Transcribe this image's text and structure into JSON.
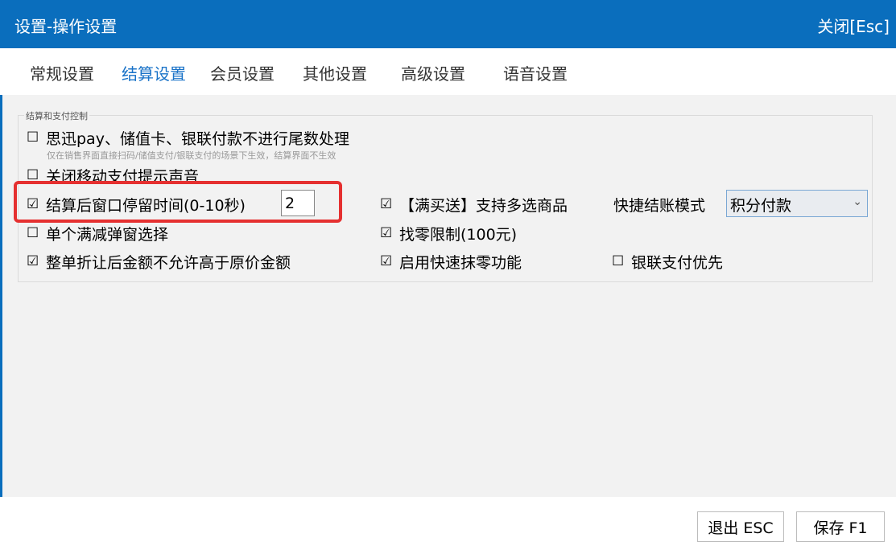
{
  "window": {
    "title": "设置-操作设置",
    "close_label": "关闭[Esc]"
  },
  "tabs": [
    {
      "label": "常规设置",
      "active": false
    },
    {
      "label": "结算设置",
      "active": true
    },
    {
      "label": "会员设置",
      "active": false
    },
    {
      "label": "其他设置",
      "active": false
    },
    {
      "label": "高级设置",
      "active": false
    },
    {
      "label": "语音设置",
      "active": false
    }
  ],
  "group": {
    "title": "结算和支付控制",
    "options": {
      "no_rounding": {
        "label": "思迅pay、储值卡、银联付款不进行尾数处理",
        "checked": false
      },
      "no_rounding_hint": "仅在销售界面直接扫码/储值支付/银联支付的场景下生效，结算界面不生效",
      "close_sound": {
        "label": "关闭移动支付提示声音",
        "checked": false
      },
      "stay_time": {
        "label": "结算后窗口停留时间(0-10秒)",
        "checked": true,
        "value": "2"
      },
      "multi_select": {
        "label": "【满买送】支持多选商品",
        "checked": true
      },
      "quick_checkout_label": "快捷结账模式",
      "quick_checkout_value": "积分付款",
      "single_popup": {
        "label": "单个满减弹窗选择",
        "checked": false
      },
      "change_limit": {
        "label": "找零限制(100元)",
        "checked": true
      },
      "discount_limit": {
        "label": "整单折让后金额不允许高于原价金额",
        "checked": true
      },
      "quick_round": {
        "label": "启用快速抹零功能",
        "checked": true
      },
      "unionpay_first": {
        "label": "银联支付优先",
        "checked": false
      }
    }
  },
  "footer": {
    "exit_label": "退出 ESC",
    "save_label": "保存 F1"
  },
  "glyphs": {
    "checked": "☑",
    "unchecked": "☐",
    "arrow": "⌄"
  },
  "colors": {
    "titlebar": "#0a6ebd",
    "active_tab": "#1a73c8",
    "highlight": "#e53030"
  }
}
